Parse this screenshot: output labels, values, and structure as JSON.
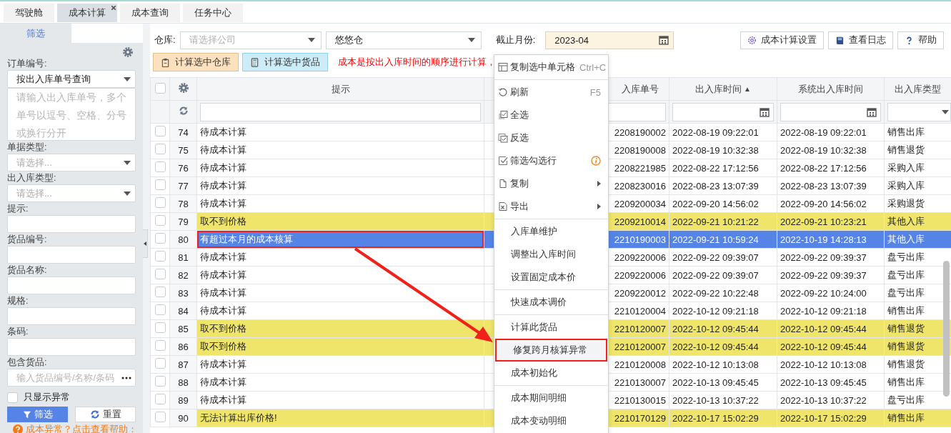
{
  "tabs": [
    {
      "label": "驾驶舱",
      "selected": false,
      "closable": false
    },
    {
      "label": "成本计算",
      "selected": true,
      "closable": true
    },
    {
      "label": "成本查询",
      "selected": false,
      "closable": false
    },
    {
      "label": "任务中心",
      "selected": false,
      "closable": false
    }
  ],
  "sidebar": {
    "tab": "筛选",
    "fields": [
      {
        "kind": "select",
        "label": "订单编号:",
        "value": "按出入库单号查询"
      },
      {
        "kind": "textarea",
        "placeholder": "请输入出入库单号，多个单号以逗号、空格、分号或换行分开"
      },
      {
        "kind": "select",
        "label": "单据类型:",
        "placeholder": "请选择..."
      },
      {
        "kind": "select",
        "label": "出入库类型:",
        "placeholder": "请选择..."
      },
      {
        "kind": "input",
        "label": "提示:"
      },
      {
        "kind": "input",
        "label": "货品编号:"
      },
      {
        "kind": "input",
        "label": "货品名称:"
      },
      {
        "kind": "input",
        "label": "规格:"
      },
      {
        "kind": "input",
        "label": "条码:"
      },
      {
        "kind": "picker",
        "label": "包含货品:",
        "placeholder": "输入货品编号/名称/条码"
      },
      {
        "kind": "checkbox",
        "label": "只显示异常",
        "checked": false
      }
    ],
    "buttons": [
      {
        "label": "筛选",
        "kind": "primary"
      },
      {
        "label": "重置",
        "kind": "reset"
      }
    ],
    "help_link": "成本异常？点击查看帮助："
  },
  "toolbar": {
    "warehouse_label": "仓库:",
    "company_placeholder": "请选择公司",
    "warehouse_value": "悠悠仓",
    "month_label": "截止月份:",
    "month_value": "2023-04",
    "buttons": [
      {
        "label": "成本计算设置",
        "kind": "settings"
      },
      {
        "label": "查看日志",
        "kind": "log"
      },
      {
        "label": "帮助",
        "kind": "help"
      }
    ]
  },
  "actions": {
    "buttons": [
      {
        "label": "计算选中仓库",
        "kind": "warehouse"
      },
      {
        "label": "计算选中货品",
        "kind": "goods"
      }
    ],
    "notice": "成本是按出入库时间的顺序进行计算，"
  },
  "table": {
    "all_checked": false,
    "columns": [
      {
        "label": "提示"
      },
      {
        "label": "入库单号"
      },
      {
        "label": "出入库时间",
        "sort_mark": "▲"
      },
      {
        "label": "系统出入库时间"
      },
      {
        "label": "出入库类型"
      }
    ],
    "rows": [
      {
        "no": "74",
        "cells": [
          "待成本计算",
          "2208190002",
          "2022-08-19 09:22:01",
          "2022-08-19 09:22:01",
          "销售出库"
        ],
        "checked": false,
        "warning": false,
        "selected": false,
        "marked": false
      },
      {
        "no": "75",
        "cells": [
          "待成本计算",
          "2208190008",
          "2022-08-19 10:32:38",
          "2022-08-19 10:32:38",
          "销售退货"
        ],
        "checked": false,
        "warning": false,
        "selected": false,
        "marked": false
      },
      {
        "no": "76",
        "cells": [
          "待成本计算",
          "2208221985",
          "2022-08-22 17:12:56",
          "2022-08-22 17:12:56",
          "采购入库"
        ],
        "checked": false,
        "warning": false,
        "selected": false,
        "marked": false
      },
      {
        "no": "77",
        "cells": [
          "待成本计算",
          "2208230016",
          "2022-08-23 13:07:39",
          "2022-08-23 13:07:39",
          "采购入库"
        ],
        "checked": false,
        "warning": false,
        "selected": false,
        "marked": false
      },
      {
        "no": "78",
        "cells": [
          "待成本计算",
          "2209200034",
          "2022-09-20 14:56:02",
          "2022-09-20 14:56:02",
          "采购退货"
        ],
        "checked": false,
        "warning": false,
        "selected": false,
        "marked": false
      },
      {
        "no": "79",
        "cells": [
          "取不到价格",
          "2209210014",
          "2022-09-21 10:21:22",
          "2022-09-21 10:23:21",
          "其他入库"
        ],
        "checked": false,
        "warning": true,
        "selected": false,
        "marked": false
      },
      {
        "no": "80",
        "cells": [
          "有超过本月的成本核算",
          "2210190003",
          "2022-09-21 10:59:24",
          "2022-10-19 14:28:13",
          "其他入库"
        ],
        "checked": false,
        "warning": false,
        "selected": true,
        "marked": true
      },
      {
        "no": "81",
        "cells": [
          "待成本计算",
          "2209220006",
          "2022-09-22 09:39:07",
          "2022-09-22 09:39:37",
          "盘亏出库"
        ],
        "checked": false,
        "warning": false,
        "selected": false,
        "marked": false
      },
      {
        "no": "82",
        "cells": [
          "待成本计算",
          "2209220006",
          "2022-09-22 09:39:07",
          "2022-09-22 09:39:37",
          "盘亏出库"
        ],
        "checked": false,
        "warning": false,
        "selected": false,
        "marked": false
      },
      {
        "no": "83",
        "cells": [
          "待成本计算",
          "2209220012",
          "2022-09-22 10:22:48",
          "2022-09-22 10:24:00",
          "盘亏出库"
        ],
        "checked": false,
        "warning": false,
        "selected": false,
        "marked": false
      },
      {
        "no": "84",
        "cells": [
          "待成本计算",
          "2210120004",
          "2022-10-12 09:21:18",
          "2022-10-12 09:21:18",
          "销售出库"
        ],
        "checked": false,
        "warning": false,
        "selected": false,
        "marked": false
      },
      {
        "no": "85",
        "cells": [
          "取不到价格",
          "2210120007",
          "2022-10-12 09:45:44",
          "2022-10-12 09:45:44",
          "销售退货"
        ],
        "checked": false,
        "warning": true,
        "selected": false,
        "marked": false
      },
      {
        "no": "86",
        "cells": [
          "取不到价格",
          "2210120007",
          "2022-10-12 09:45:44",
          "2022-10-12 09:45:44",
          "销售退货"
        ],
        "checked": false,
        "warning": true,
        "selected": false,
        "marked": false
      },
      {
        "no": "87",
        "cells": [
          "待成本计算",
          "2210120008",
          "2022-10-12 10:13:08",
          "2022-10-12 10:13:08",
          "销售退货"
        ],
        "checked": false,
        "warning": false,
        "selected": false,
        "marked": false
      },
      {
        "no": "88",
        "cells": [
          "待成本计算",
          "2210130007",
          "2022-10-13 09:45:45",
          "2022-10-13 09:45:45",
          "销售出库"
        ],
        "checked": false,
        "warning": false,
        "selected": false,
        "marked": false
      },
      {
        "no": "89",
        "cells": [
          "待成本计算",
          "2210130015",
          "2022-10-13 10:37:22",
          "2022-10-13 10:37:22",
          "盘亏出库"
        ],
        "checked": false,
        "warning": false,
        "selected": false,
        "marked": false
      },
      {
        "no": "90",
        "cells": [
          "无法计算出库价格!",
          "2210170129",
          "2022-10-17 15:02:29",
          "2022-10-17 15:02:29",
          "销售出库"
        ],
        "checked": false,
        "warning": true,
        "selected": false,
        "marked": false
      }
    ]
  },
  "context_menu": {
    "items": [
      {
        "kind": "item",
        "label": "复制选中单元格",
        "shortcut": "Ctrl+C",
        "marked": false
      },
      {
        "kind": "separator"
      },
      {
        "kind": "item",
        "label": "刷新",
        "shortcut": "F5",
        "marked": false
      },
      {
        "kind": "item",
        "label": "全选",
        "marked": false
      },
      {
        "kind": "item",
        "label": "反选",
        "marked": false
      },
      {
        "kind": "item",
        "label": "筛选勾选行",
        "info": true,
        "marked": false
      },
      {
        "kind": "item",
        "label": "复制",
        "submenu": true,
        "marked": false
      },
      {
        "kind": "item",
        "label": "导出",
        "submenu": true,
        "marked": false
      },
      {
        "kind": "separator"
      },
      {
        "kind": "item",
        "label": "入库单维护",
        "marked": false
      },
      {
        "kind": "item",
        "label": "调整出入库时间",
        "marked": false
      },
      {
        "kind": "item",
        "label": "设置固定成本价",
        "marked": false
      },
      {
        "kind": "separator"
      },
      {
        "kind": "item",
        "label": "快速成本调价",
        "marked": false
      },
      {
        "kind": "separator"
      },
      {
        "kind": "item",
        "label": "计算此货品",
        "marked": false
      },
      {
        "kind": "item",
        "label": "修复跨月核算异常",
        "marked": true
      },
      {
        "kind": "item",
        "label": "成本初始化",
        "marked": false
      },
      {
        "kind": "separator"
      },
      {
        "kind": "item",
        "label": "成本期间明细",
        "marked": false
      },
      {
        "kind": "item",
        "label": "成本变动明细",
        "marked": false
      }
    ]
  }
}
